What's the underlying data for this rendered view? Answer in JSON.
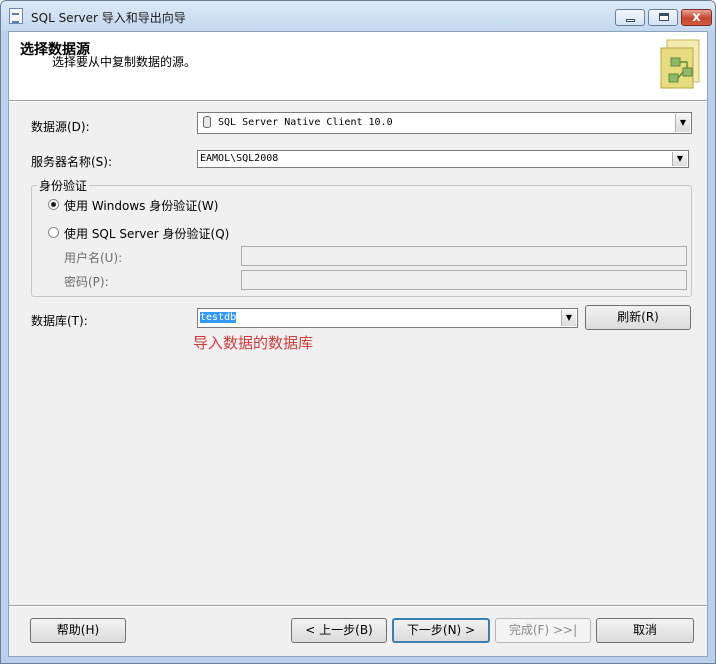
{
  "window": {
    "title": "SQL Server 导入和导出向导",
    "close_glyph": "x"
  },
  "header": {
    "title": "选择数据源",
    "subtitle": "选择要从中复制数据的源。"
  },
  "form": {
    "datasource_label": "数据源(D):",
    "datasource_value": "SQL Server Native Client 10.0",
    "servername_label": "服务器名称(S):",
    "servername_value": "EAMOL\\SQL2008",
    "auth_group_label": "身份验证",
    "auth_windows_label": "使用 Windows 身份验证(W)",
    "auth_windows_checked": true,
    "auth_sql_label": "使用 SQL Server 身份验证(Q)",
    "auth_sql_checked": false,
    "username_label": "用户名(U):",
    "username_value": "",
    "password_label": "密码(P):",
    "password_value": "",
    "database_label": "数据库(T):",
    "database_value": "testdb",
    "refresh_button": "刷新(R)",
    "dropdown_arrow": "▼"
  },
  "annotation": "导入数据的数据库",
  "footer": {
    "help_button": "帮助(H)",
    "back_button": "< 上一步(B)",
    "next_button": "下一步(N) >",
    "finish_button": "完成(F) >>|",
    "cancel_button": "取消"
  },
  "colors": {
    "annotation": "#d23c3c",
    "selection": "#3399ff",
    "focus_border": "#3c7fb1"
  }
}
